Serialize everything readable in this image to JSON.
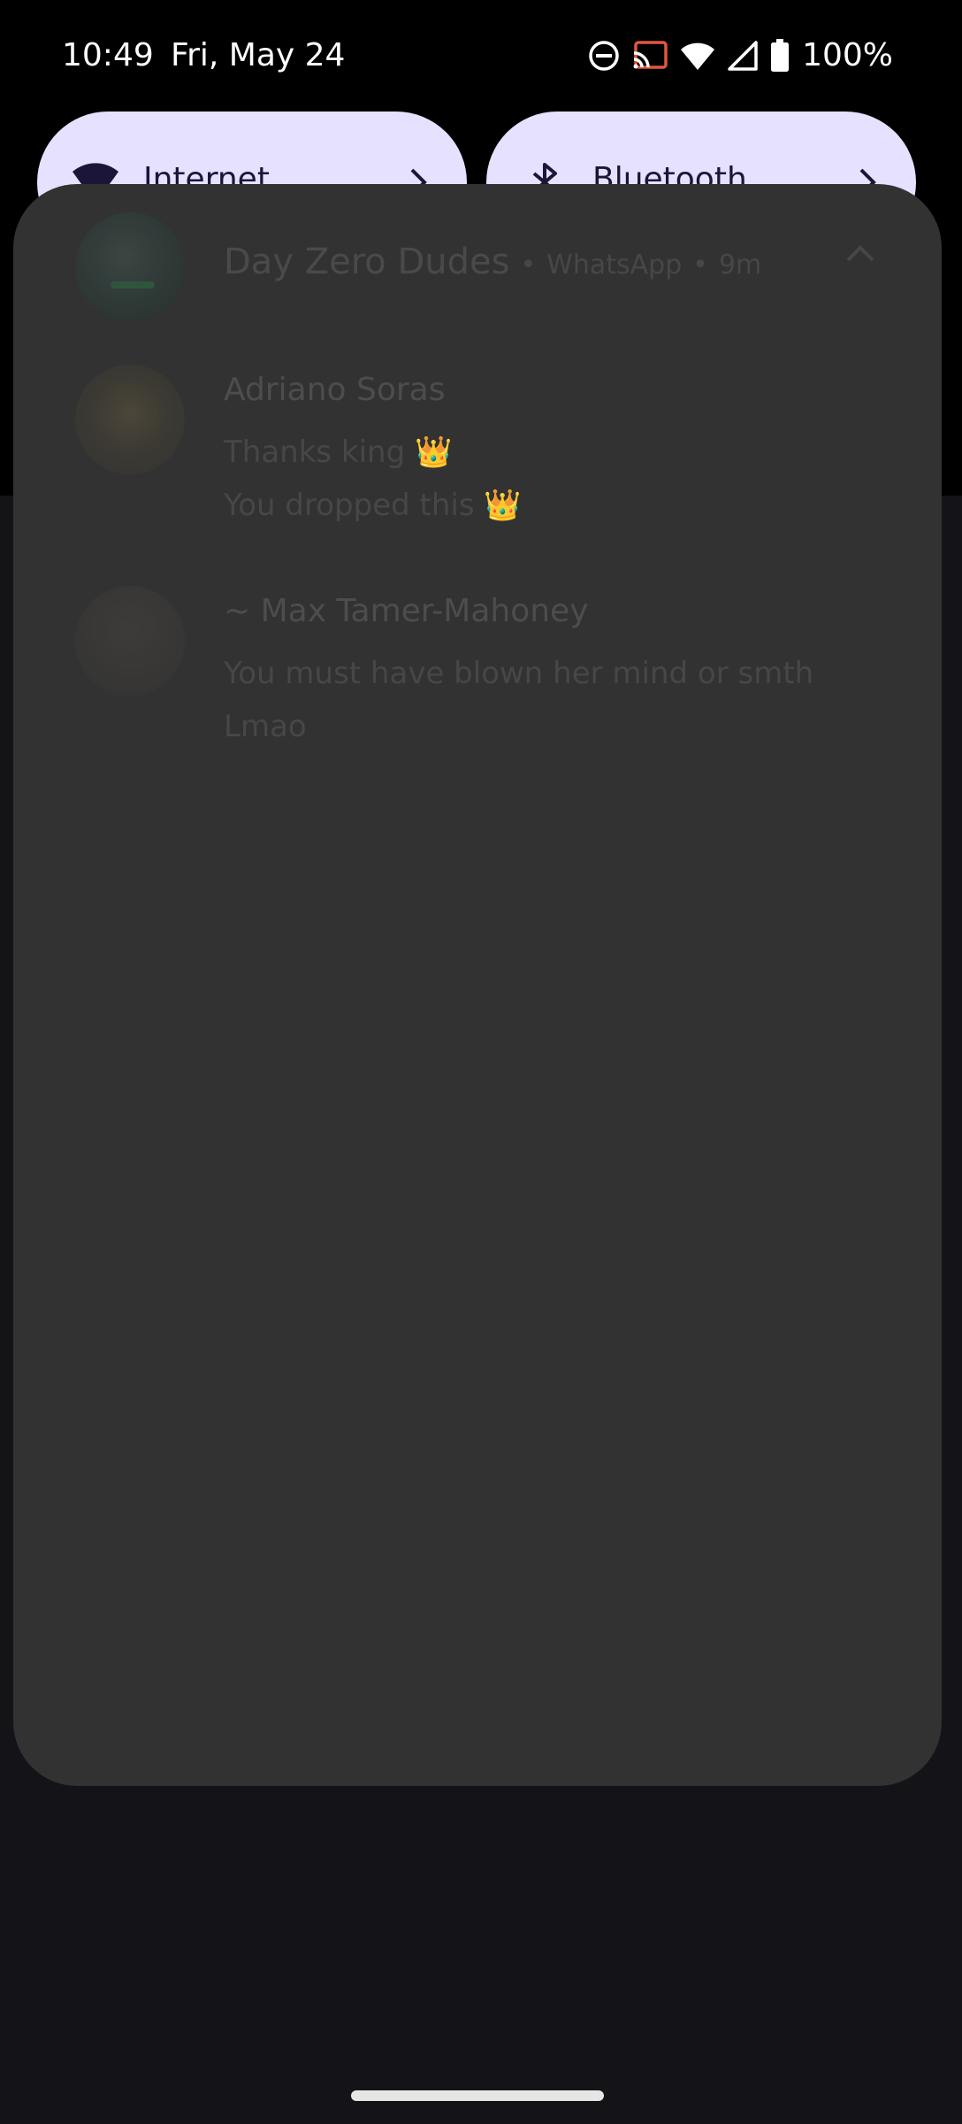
{
  "status_bar": {
    "time": "10:49",
    "date": "Fri, May 24",
    "battery": "100%",
    "icons": [
      "do-not-disturb-icon",
      "cast-icon",
      "wifi-icon",
      "cell-signal-icon",
      "battery-icon"
    ]
  },
  "quick_settings": {
    "tiles": [
      {
        "label": "Internet",
        "icon": "wifi-icon"
      },
      {
        "label": "Bluetooth",
        "icon": "bluetooth-icon"
      }
    ],
    "tile_color": "#e6e1ff"
  },
  "notification": {
    "group_name": "Day Zero Dudes",
    "app": "WhatsApp",
    "time_ago": "9m",
    "messages": [
      {
        "sender": "Adriano Soras",
        "lines": [
          "Thanks king 👑",
          "You dropped this 👑"
        ]
      },
      {
        "sender": "~ Max Tamer-Mahoney",
        "lines": [
          "You must have blown her mind or smth",
          "Lmao"
        ]
      }
    ]
  },
  "colors": {
    "shade": "#323232",
    "background": "#000000",
    "lower_background": "#131318"
  }
}
